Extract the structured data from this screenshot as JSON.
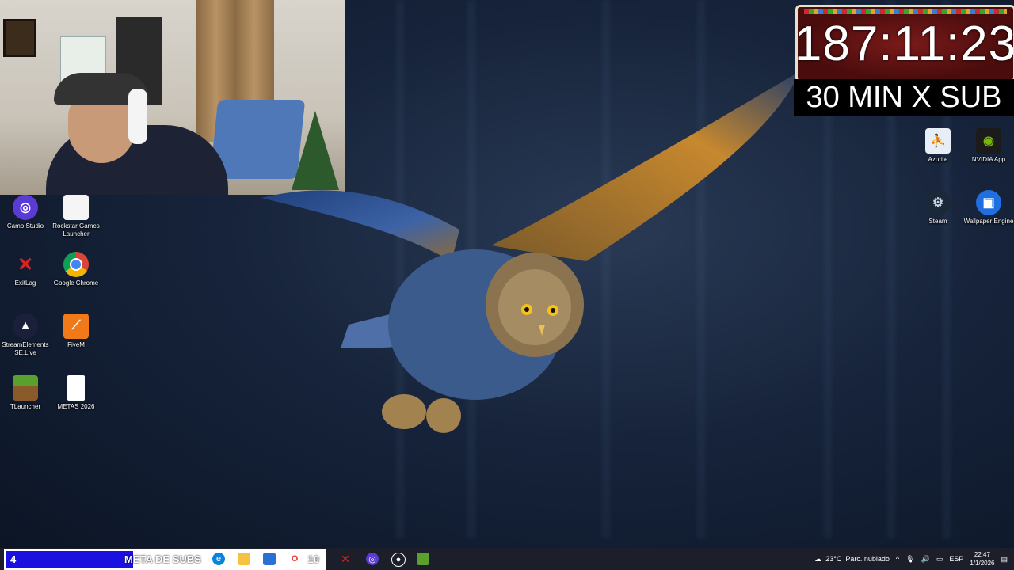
{
  "timer": {
    "value": "187:11:23"
  },
  "promo": {
    "text": "30 MIN X SUB"
  },
  "desktop_icons_left": [
    {
      "label": "Camo Studio",
      "icon": "camo-studio-icon"
    },
    {
      "label": "Rockstar Games Launcher",
      "icon": "rockstar-icon"
    },
    {
      "label": "ExitLag",
      "icon": "exitlag-icon"
    },
    {
      "label": "Google Chrome",
      "icon": "chrome-icon"
    },
    {
      "label": "StreamElements SE.Live",
      "icon": "streamelements-icon"
    },
    {
      "label": "FiveM",
      "icon": "fivem-icon"
    },
    {
      "label": "TLauncher",
      "icon": "tlauncher-icon"
    },
    {
      "label": "METAS 2026",
      "icon": "text-file-icon"
    }
  ],
  "desktop_icons_right": [
    {
      "label": "Azurite",
      "icon": "azurite-icon"
    },
    {
      "label": "NVIDIA App",
      "icon": "nvidia-icon"
    },
    {
      "label": "Steam",
      "icon": "steam-icon"
    },
    {
      "label": "Wallpaper Engine",
      "icon": "wallpaper-engine-icon"
    }
  ],
  "goal_bar": {
    "start": "4",
    "title": "META DE SUBS",
    "end": "10",
    "progress": 0.4,
    "fill_color": "#1a10e0"
  },
  "tray": {
    "temperature": "23°C",
    "weather": "Parc. nublado",
    "language": "ESP",
    "time": "22:47",
    "date": "1/1/2026"
  }
}
